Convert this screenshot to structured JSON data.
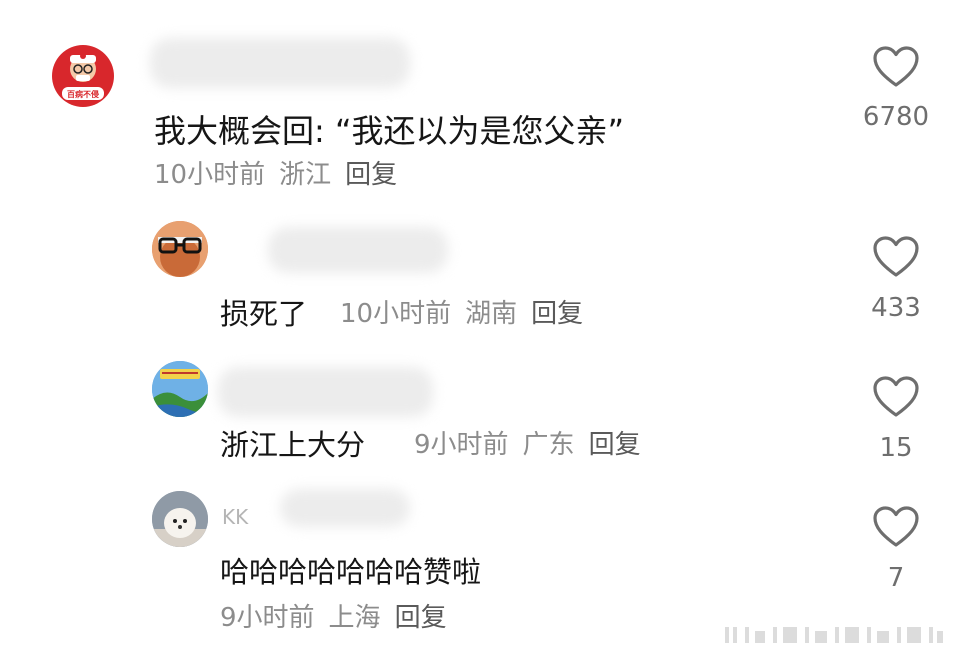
{
  "comments": [
    {
      "text": "我大概会回: “我还以为是您父亲”",
      "time": "10小时前",
      "location": "浙江",
      "reply_label": "回复",
      "likes": "6780",
      "avatar_caption": "百病不侵"
    },
    {
      "text": "损死了",
      "time": "10小时前",
      "location": "湖南",
      "reply_label": "回复",
      "likes": "433"
    },
    {
      "text": "浙江上大分",
      "time": "9小时前",
      "location": "广东",
      "reply_label": "回复",
      "likes": "15"
    },
    {
      "username_partial": "KK",
      "text": "哈哈哈哈哈哈哈赞啦",
      "time": "9小时前",
      "location": "上海",
      "reply_label": "回复",
      "likes": "7"
    }
  ],
  "colors": {
    "avatar1_bg": "#d8272c",
    "heart_stroke": "#6e6e6e",
    "meta_text": "#8c8c8c"
  }
}
